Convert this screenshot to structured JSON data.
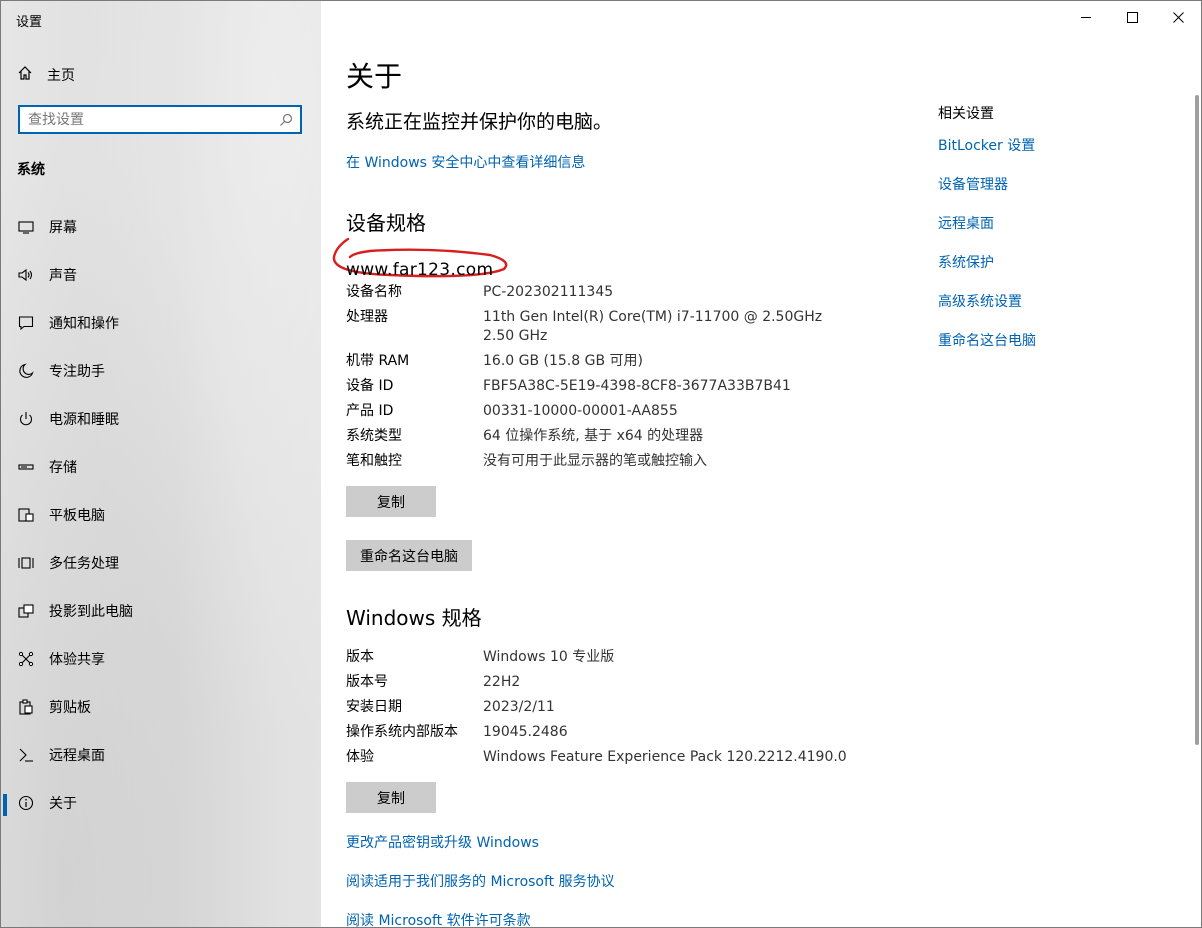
{
  "window": {
    "title": "设置"
  },
  "sidebar": {
    "home_label": "主页",
    "search_placeholder": "查找设置",
    "section_label": "系统",
    "items": [
      {
        "label": "屏幕",
        "icon": "monitor-icon"
      },
      {
        "label": "声音",
        "icon": "speaker-icon"
      },
      {
        "label": "通知和操作",
        "icon": "notification-icon"
      },
      {
        "label": "专注助手",
        "icon": "moon-icon"
      },
      {
        "label": "电源和睡眠",
        "icon": "power-icon"
      },
      {
        "label": "存储",
        "icon": "storage-icon"
      },
      {
        "label": "平板电脑",
        "icon": "tablet-icon"
      },
      {
        "label": "多任务处理",
        "icon": "multitask-icon"
      },
      {
        "label": "投影到此电脑",
        "icon": "project-icon"
      },
      {
        "label": "体验共享",
        "icon": "share-icon"
      },
      {
        "label": "剪贴板",
        "icon": "clipboard-icon"
      },
      {
        "label": "远程桌面",
        "icon": "remote-icon"
      },
      {
        "label": "关于",
        "icon": "info-icon",
        "active": true
      }
    ]
  },
  "main": {
    "title": "关于",
    "protect_text": "系统正在监控并保护你的电脑。",
    "security_link": "在 Windows 安全中心中查看详细信息",
    "device_specs_heading": "设备规格",
    "watermark": "www.far123.com",
    "device_specs": [
      {
        "k": "设备名称",
        "v": "PC-202302111345"
      },
      {
        "k": "处理器",
        "v": "11th Gen Intel(R) Core(TM) i7-11700 @ 2.50GHz",
        "v2": "2.50 GHz"
      },
      {
        "k": "机带 RAM",
        "v": "16.0 GB (15.8 GB 可用)"
      },
      {
        "k": "设备 ID",
        "v": "FBF5A38C-5E19-4398-8CF8-3677A33B7B41"
      },
      {
        "k": "产品 ID",
        "v": "00331-10000-00001-AA855"
      },
      {
        "k": "系统类型",
        "v": "64 位操作系统, 基于 x64 的处理器"
      },
      {
        "k": "笔和触控",
        "v": "没有可用于此显示器的笔或触控输入"
      }
    ],
    "copy_label": "复制",
    "rename_label": "重命名这台电脑",
    "windows_specs_heading": "Windows 规格",
    "windows_specs": [
      {
        "k": "版本",
        "v": "Windows 10 专业版"
      },
      {
        "k": "版本号",
        "v": "22H2"
      },
      {
        "k": "安装日期",
        "v": "2023/2/11"
      },
      {
        "k": "操作系统内部版本",
        "v": "19045.2486"
      },
      {
        "k": "体验",
        "v": "Windows Feature Experience Pack 120.2212.4190.0"
      }
    ],
    "copy2_label": "复制",
    "links": [
      "更改产品密钥或升级 Windows",
      "阅读适用于我们服务的 Microsoft 服务协议",
      "阅读 Microsoft 软件许可条款"
    ]
  },
  "related": {
    "title": "相关设置",
    "links": [
      "BitLocker 设置",
      "设备管理器",
      "远程桌面",
      "系统保护",
      "高级系统设置",
      "重命名这台电脑"
    ]
  },
  "colors": {
    "accent": "#0063b1",
    "sidebar_bg": "#e0e0e0",
    "button_bg": "#cccccc"
  }
}
